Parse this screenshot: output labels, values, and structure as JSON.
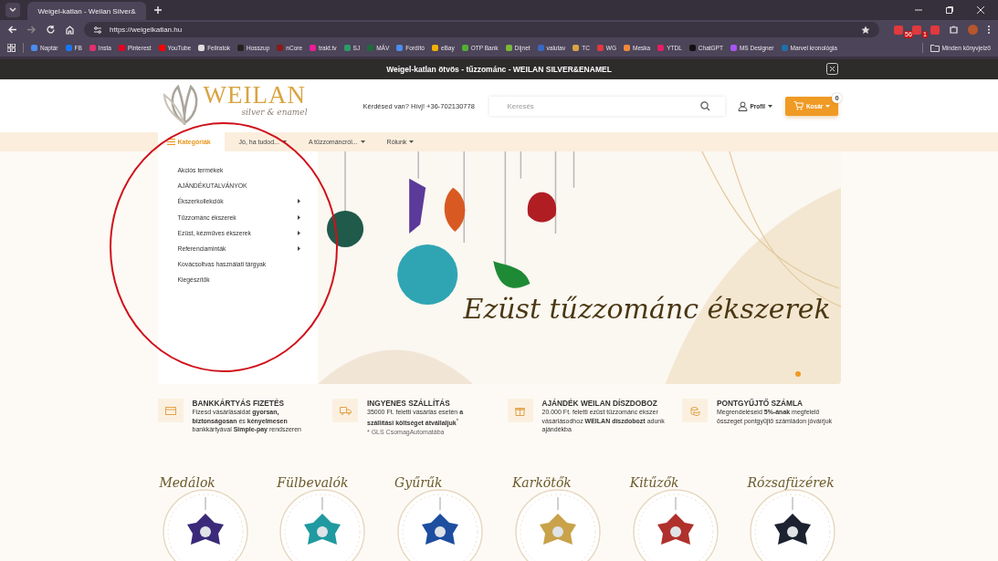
{
  "browser": {
    "tab_title": "Weigel-katlan - Weilan Silver&",
    "url": "https://weigelkatlan.hu",
    "extensions": [
      {
        "badge": "56",
        "color": "#e0393e"
      },
      {
        "badge": "1",
        "color": "#e0393e"
      },
      {
        "color": "#e0393e"
      }
    ],
    "bookmarks": [
      {
        "label": "Naptár",
        "color": "#4a8df0"
      },
      {
        "label": "FB",
        "color": "#1877f2"
      },
      {
        "label": "Insta",
        "color": "#e1306c"
      },
      {
        "label": "Pinterest",
        "color": "#e60023"
      },
      {
        "label": "YouTube",
        "color": "#ff0000"
      },
      {
        "label": "Feliratok",
        "color": "#dddddd"
      },
      {
        "label": "Hosszup",
        "color": "#222222"
      },
      {
        "label": "nCore",
        "color": "#8b1a1a"
      },
      {
        "label": "trakt.tv",
        "color": "#ed1c9a"
      },
      {
        "label": "SJ",
        "color": "#2e9b6a"
      },
      {
        "label": "MÁV",
        "color": "#1d6b3a"
      },
      {
        "label": "Fordító",
        "color": "#4a8df0"
      },
      {
        "label": "eBay",
        "color": "#f5af02"
      },
      {
        "label": "OTP Bank",
        "color": "#52ae32"
      },
      {
        "label": "Díjnet",
        "color": "#7bb83a"
      },
      {
        "label": "valutav",
        "color": "#3a66c4"
      },
      {
        "label": "TC",
        "color": "#d9a441"
      },
      {
        "label": "WG",
        "color": "#e0393e"
      },
      {
        "label": "Meska",
        "color": "#f08a3a"
      },
      {
        "label": "YTDL",
        "color": "#e91e63"
      },
      {
        "label": "ChatGPT",
        "color": "#111111"
      },
      {
        "label": "MS Designer",
        "color": "#a855f7"
      },
      {
        "label": "Marvel kronológia",
        "color": "#1f6fa8"
      }
    ],
    "all_bookmarks": "Minden könyvjelző"
  },
  "announcement": "Weigel-katlan ötvös - tűzzománc - WEILAN SILVER&ENAMEL",
  "header": {
    "logo": "WEILAN",
    "tagline": "silver & enamel",
    "contact": "Kérdésed van? Hívj! +36-702130778",
    "search": {
      "placeholder": "Keresés"
    },
    "profile": "Profil",
    "cart": {
      "label": "Kosár",
      "count": "0"
    }
  },
  "nav": [
    {
      "label": "Kategóriák",
      "selected": true,
      "dropdown": false
    },
    {
      "label": "Jó, ha tudod...",
      "selected": false,
      "dropdown": true
    },
    {
      "label": "A tűzzománcról...",
      "selected": false,
      "dropdown": true
    },
    {
      "label": "Rólunk",
      "selected": false,
      "dropdown": true
    }
  ],
  "categories_menu": [
    {
      "label": "Akciós termékek",
      "has_submenu": false
    },
    {
      "label": "AJÁNDÉKUTALVÁNYOK",
      "has_submenu": false
    },
    {
      "label": "Ékszerkollekciók",
      "has_submenu": true
    },
    {
      "label": "Tűzzománc ékszerek",
      "has_submenu": true
    },
    {
      "label": "Ezüst, kézműves ékszerek",
      "has_submenu": true
    },
    {
      "label": "Referenciaminták",
      "has_submenu": true
    },
    {
      "label": "Kovácsoltvas használati tárgyak",
      "has_submenu": false
    },
    {
      "label": "Kiegészítők",
      "has_submenu": false
    }
  ],
  "hero": {
    "title": "Ezüst tűzzománc ékszerek",
    "slides": [
      {
        "selected": true
      }
    ]
  },
  "features": [
    {
      "kind": "card",
      "title": "BANKKÁRTYÁS FIZETÉS",
      "text": "Fizesd vásárlásaidat **gyorsan, biztonságosan** és **kényelmesen** bankkártyával **Simple-pay** rendszeren"
    },
    {
      "kind": "truck",
      "title": "INGYENES SZÁLLÍTÁS",
      "text": "35000 Ft. feletti vásárlás esetén **a szállítási költséget átvállaljuk**$^{*}$",
      "note": "* GLS CsomagAutomatába"
    },
    {
      "kind": "gift",
      "title": "AJÁNDÉK WEILAN DÍSZDOBOZ",
      "text": "20.000 Ft. feletti ezüst tűzzománc ékszer vásárlásodhoz **WEILAN díszdobozt** adunk ajándékba"
    },
    {
      "kind": "coins",
      "title": "PONTGYŰJTŐ SZÁMLA",
      "text": "Megrendeléseid **5%-ának** megfelelő összeget pontgyűjtő számládon jóváírjuk"
    }
  ],
  "product_categories": [
    {
      "label": "Medálok",
      "kind": "picture"
    },
    {
      "label": "Fülbevalók",
      "kind": "picture"
    },
    {
      "label": "Gyűrűk",
      "kind": "picture"
    },
    {
      "label": "Karkötők",
      "kind": "picture"
    },
    {
      "label": "Kitűzők",
      "kind": "picture"
    },
    {
      "label": "Rózsafüzérek",
      "kind": "picture"
    }
  ]
}
